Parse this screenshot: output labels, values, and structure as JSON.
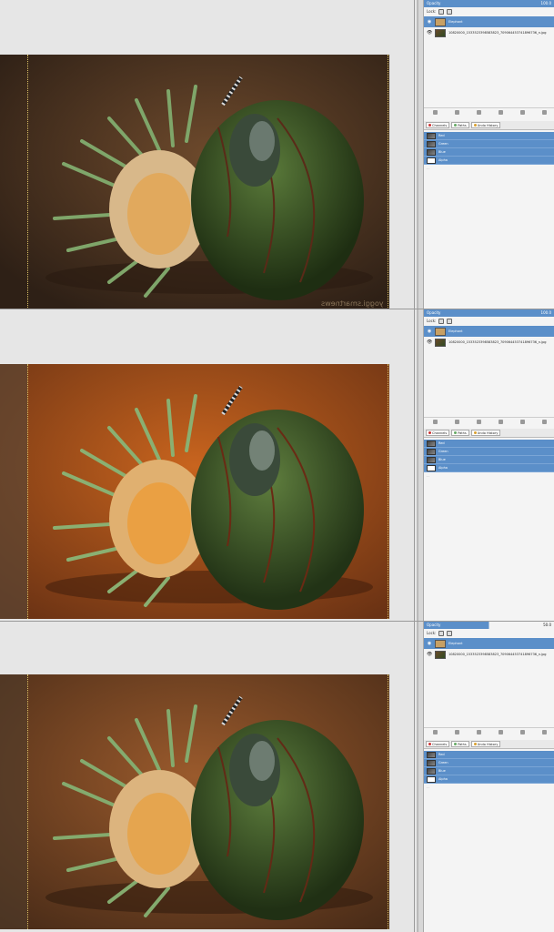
{
  "panels": [
    {
      "opacity_label": "Opacity",
      "opacity_value": "100.0",
      "lock_label": "Lock:",
      "layers": [
        {
          "name": "Elephant",
          "selected": true
        },
        {
          "name": "10820000_1533523398583823_709064453741896736_n.jpg",
          "selected": false
        }
      ],
      "tabs": [
        "Channels",
        "Paths",
        "Undo History"
      ],
      "channels": [
        "Red",
        "Green",
        "Blue",
        "Alpha"
      ],
      "watermark": "yoggi.smartnews"
    },
    {
      "opacity_label": "Opacity",
      "opacity_value": "100.0",
      "lock_label": "Lock:",
      "layers": [
        {
          "name": "Elephant",
          "selected": true
        },
        {
          "name": "10820000_1533523398583823_709064453741896736_n.jpg",
          "selected": false
        }
      ],
      "tabs": [
        "Channels",
        "Paths",
        "Undo History"
      ],
      "channels": [
        "Red",
        "Green",
        "Blue",
        "Alpha"
      ]
    },
    {
      "opacity_label": "Opacity",
      "opacity_value": "50.0",
      "lock_label": "Lock:",
      "layers": [
        {
          "name": "Elephant",
          "selected": true
        },
        {
          "name": "10820000_1533523398583823_709064453741896736_n.jpg",
          "selected": false
        }
      ],
      "tabs": [
        "Channels",
        "Paths",
        "Undo History"
      ],
      "channels": [
        "Red",
        "Green",
        "Blue",
        "Alpha"
      ]
    }
  ],
  "colors": {
    "selection_blue": "#5b8fc9",
    "guide": "#d8c066",
    "bg_dark_top": "#3b2a1c",
    "bg_orange_mid": "#b4561c",
    "bg_mid_bottom": "#7a4320",
    "body_green": "#2f4a1f",
    "leg_green": "#7fa66a"
  },
  "icons": [
    "eye-icon",
    "lock-pixels-icon",
    "lock-alpha-icon",
    "new-layer-icon",
    "folder-icon",
    "anchor-icon",
    "duplicate-icon",
    "merge-icon",
    "delete-icon"
  ]
}
